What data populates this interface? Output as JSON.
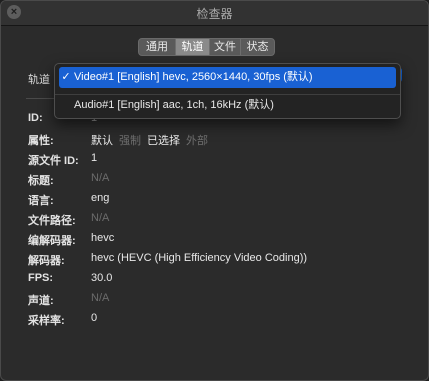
{
  "window": {
    "title": "检查器",
    "close_glyph": "×"
  },
  "tabs": [
    {
      "label": "通用",
      "active": false
    },
    {
      "label": "轨道",
      "active": true
    },
    {
      "label": "文件",
      "active": false
    },
    {
      "label": "状态",
      "active": false
    }
  ],
  "track_label": "轨道",
  "dropdown": {
    "items": [
      {
        "check": "✓",
        "label": "Video#1 [English] hevc, 2560×1440, 30fps (默认)",
        "selected": true
      },
      {
        "check": "",
        "label": "Audio#1 [English] aac, 1ch, 16kHz (默认)",
        "selected": false
      }
    ]
  },
  "fields": {
    "id": {
      "label": "ID:",
      "value": "1"
    },
    "attr": {
      "label": "属性:",
      "values": [
        {
          "text": "默认",
          "enabled": true
        },
        {
          "text": "强制",
          "enabled": false
        },
        {
          "text": "已选择",
          "enabled": true
        },
        {
          "text": "外部",
          "enabled": false
        }
      ]
    },
    "source_id": {
      "label": "源文件 ID:",
      "value": "1"
    },
    "title": {
      "label": "标题:",
      "value": "N/A"
    },
    "language": {
      "label": "语言:",
      "value": "eng"
    },
    "file_path": {
      "label": "文件路径:",
      "value": "N/A"
    },
    "codec": {
      "label": "编解码器:",
      "value": "hevc"
    },
    "decoder": {
      "label": "解码器:",
      "value": "hevc (HEVC (High Efficiency Video Coding))"
    },
    "fps": {
      "label": "FPS:",
      "value": "30.0"
    },
    "channels": {
      "label": "声道:",
      "value": "N/A"
    },
    "sample_rate": {
      "label": "采样率:",
      "value": "0"
    }
  },
  "colors": {
    "accent": "#1961d3",
    "disabled_text": "#6c6c6c"
  }
}
